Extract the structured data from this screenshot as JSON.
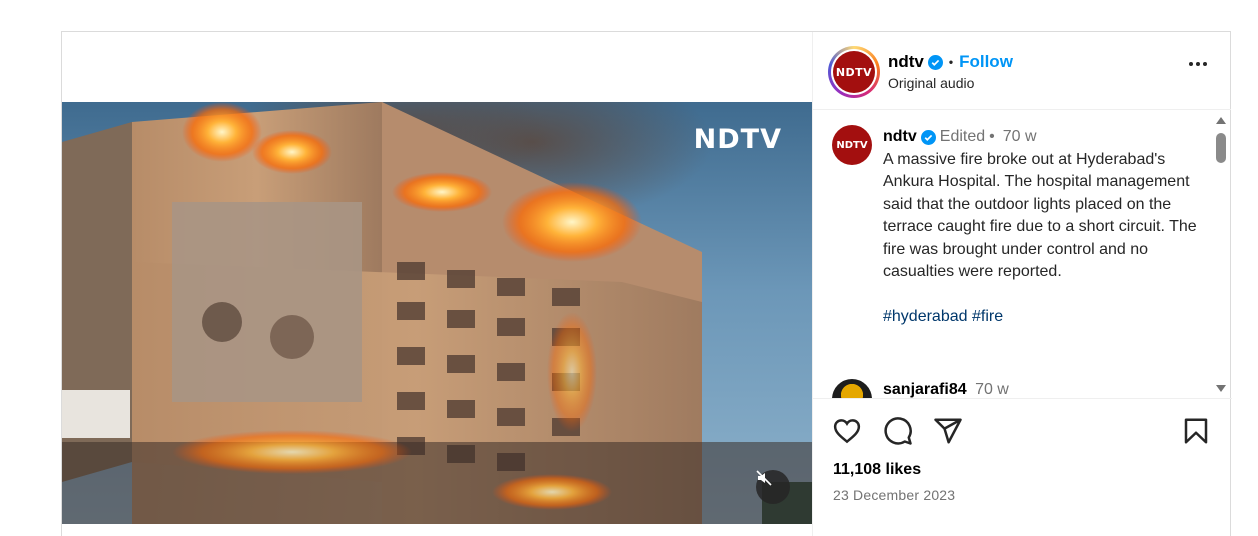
{
  "post": {
    "media": {
      "watermark": "NDTV",
      "mute_icon": "muted-speaker-icon"
    },
    "header": {
      "logo_text": "NDTV",
      "username": "ndtv",
      "verified_icon": "verified-badge-icon",
      "separator": "•",
      "follow_label": "Follow",
      "subtitle": "Original audio",
      "more_icon": "more-options-icon"
    },
    "caption": {
      "logo_text": "NDTV",
      "username": "ndtv",
      "edited": "Edited",
      "separator": "•",
      "age": "70 w",
      "text": "A massive fire broke out at Hyderabad's Ankura Hospital. The hospital management said that the outdoor lights placed on the terrace caught fire due to a short circuit. The fire was brought under control and no casualties were reported.",
      "hashtags": [
        "#hyderabad",
        "#fire"
      ]
    },
    "comment": {
      "username": "sanjarafi84",
      "age": "70 w"
    },
    "actions": {
      "like_icon": "heart-icon",
      "comment_icon": "comment-icon",
      "share_icon": "share-icon",
      "save_icon": "bookmark-icon"
    },
    "likes_text": "11,108 likes",
    "date_text": "23 December 2023"
  },
  "colors": {
    "accent": "#0095f6",
    "logo_red": "#a30f0f",
    "hashtag": "#00376b",
    "muted_text": "#737373"
  }
}
